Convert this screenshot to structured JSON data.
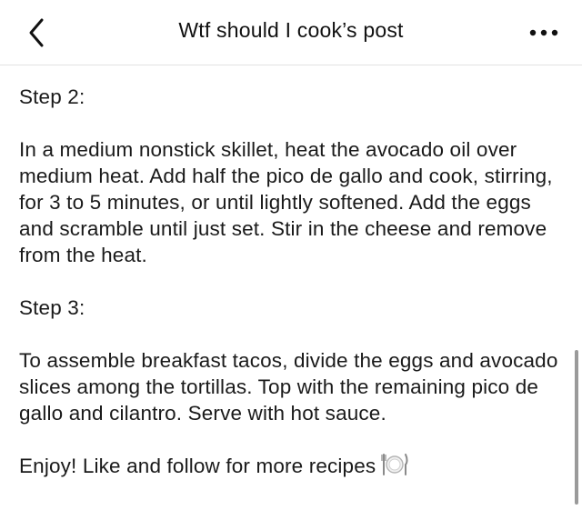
{
  "header": {
    "title": "Wtf should I cook’s post"
  },
  "post": {
    "step2_heading": "Step 2:",
    "step2_text": "In a medium nonstick skillet, heat the avocado oil over medium heat. Add half the pico de gallo and cook, stirring, for 3 to 5 minutes, or until lightly softened. Add the eggs and scramble until just set. Stir in the cheese and remove from the heat.",
    "step3_heading": "Step 3:",
    "step3_text": "To assemble breakfast tacos, divide the eggs and avocado slices among the tortillas. Top with the remaining pico de gallo and cilantro. Serve with hot sauce.",
    "closing_text": "Enjoy! Like and follow for more recipes"
  },
  "icons": {
    "back": "chevron-left-icon",
    "more": "more-horizontal-icon",
    "plate": "fork-knife-plate-icon"
  }
}
